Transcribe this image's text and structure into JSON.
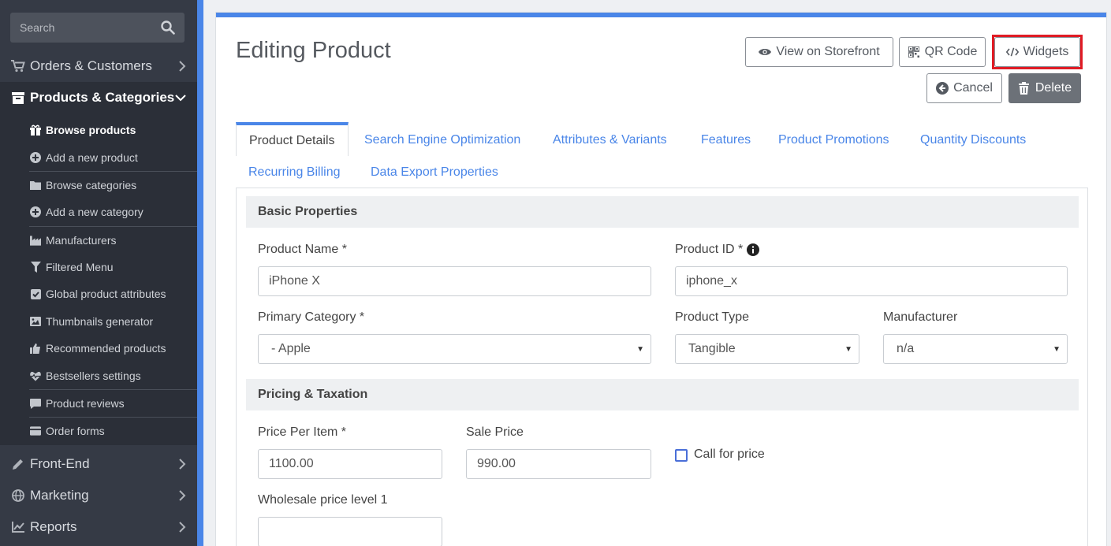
{
  "sidebar": {
    "search_placeholder": "Search",
    "main_items": [
      {
        "label": "Orders & Customers",
        "icon": "cart-icon"
      },
      {
        "label": "Products & Categories",
        "icon": "archive-icon",
        "active": true
      },
      {
        "label": "Front-End",
        "icon": "pencil-icon"
      },
      {
        "label": "Marketing",
        "icon": "globe-icon"
      },
      {
        "label": "Reports",
        "icon": "line-chart-icon"
      }
    ],
    "sub_items": [
      {
        "label": "Browse products",
        "icon": "gift-icon",
        "active": true
      },
      {
        "label": "Add a new product",
        "icon": "plus-circle-icon"
      },
      {
        "label": "Browse categories",
        "icon": "folder-icon"
      },
      {
        "label": "Add a new category",
        "icon": "plus-circle-icon"
      },
      {
        "label": "Manufacturers",
        "icon": "industry-icon"
      },
      {
        "label": "Filtered Menu",
        "icon": "filter-icon"
      },
      {
        "label": "Global product attributes",
        "icon": "check-square-icon"
      },
      {
        "label": "Thumbnails generator",
        "icon": "image-icon"
      },
      {
        "label": "Recommended products",
        "icon": "thumbs-up-icon"
      },
      {
        "label": "Bestsellers settings",
        "icon": "heartbeat-icon"
      },
      {
        "label": "Product reviews",
        "icon": "comment-icon"
      },
      {
        "label": "Order forms",
        "icon": "credit-card-icon"
      }
    ]
  },
  "header": {
    "title": "Editing Product",
    "buttons": {
      "storefront": "View on Storefront",
      "qr": "QR Code",
      "widgets": "Widgets",
      "cancel": "Cancel",
      "delete": "Delete"
    }
  },
  "tabs": [
    "Product Details",
    "Search Engine Optimization",
    "Attributes & Variants",
    "Features",
    "Product Promotions",
    "Quantity Discounts",
    "Recurring Billing",
    "Data Export Properties"
  ],
  "sections": {
    "basic": "Basic Properties",
    "pricing": "Pricing & Taxation"
  },
  "form": {
    "product_name_label": "Product Name *",
    "product_name": "iPhone X",
    "product_id_label": "Product ID *",
    "product_id": "iphone_x",
    "primary_category_label": "Primary Category *",
    "primary_category": "- Apple",
    "product_type_label": "Product Type",
    "product_type": "Tangible",
    "manufacturer_label": "Manufacturer",
    "manufacturer": "n/a",
    "price_label": "Price Per Item *",
    "price": "1100.00",
    "sale_price_label": "Sale Price",
    "sale_price": "990.00",
    "call_for_price_label": "Call for price",
    "wholesale_label": "Wholesale price level 1",
    "wholesale": ""
  },
  "colors": {
    "accent": "#4a86e8",
    "sidebar_bg": "#353a45",
    "highlight": "#e01b24"
  }
}
